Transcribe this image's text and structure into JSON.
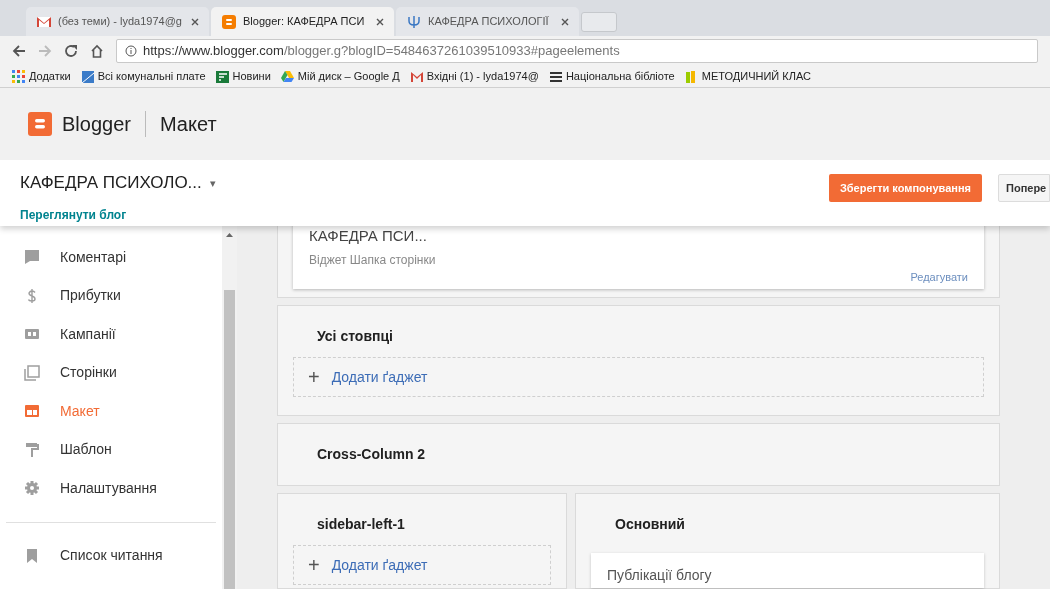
{
  "browser": {
    "tabs": [
      {
        "label": "(без теми) - lyda1974@g",
        "kind": "mail",
        "selected": false
      },
      {
        "label": "Blogger: КАФЕДРА ПСИ",
        "kind": "blogger",
        "selected": true
      },
      {
        "label": "КАФЕДРА ПСИХОЛОГІЇ",
        "kind": "psi",
        "selected": false
      }
    ],
    "url_host": "https://www.blogger.com",
    "url_path": "/blogger.g?blogID=5484637261039510933#pageelements",
    "bookmarks": [
      {
        "label": "Додатки",
        "kind": "apps"
      },
      {
        "label": "Всі комунальні плате",
        "kind": "page"
      },
      {
        "label": "Новини",
        "kind": "news"
      },
      {
        "label": "Мій диск – Google Д",
        "kind": "drive"
      },
      {
        "label": "Вхідні (1) - lyda1974@",
        "kind": "mail"
      },
      {
        "label": "Національна бібліоте",
        "kind": "lib"
      },
      {
        "label": "МЕТОДИЧНИЙ КЛАС",
        "kind": "book"
      }
    ]
  },
  "app": {
    "name": "Blogger",
    "section": "Макет"
  },
  "blog_header": {
    "title": "КАФЕДРА ПСИХОЛО...",
    "caret": "▾",
    "view_link": "Переглянути блог",
    "save_button": "Зберегти компонування",
    "preview_button": "Попере"
  },
  "sidebar": {
    "items": [
      {
        "label": "Коментарі",
        "selected": false
      },
      {
        "label": "Прибутки",
        "selected": false
      },
      {
        "label": "Кампанії",
        "selected": false
      },
      {
        "label": "Сторінки",
        "selected": false
      },
      {
        "label": "Макет",
        "selected": true
      },
      {
        "label": "Шаблон",
        "selected": false
      },
      {
        "label": "Налаштування",
        "selected": false
      }
    ],
    "bottom_items": [
      {
        "label": "Список читання",
        "selected": false
      }
    ]
  },
  "layout": {
    "header_widget": {
      "title": "КАФЕДРА ПСИ...",
      "subtitle": "Віджет Шапка сторінки",
      "edit": "Редагувати"
    },
    "all_columns": {
      "title": "Усі стовпці",
      "add": "Додати ґаджет",
      "plus": "+"
    },
    "cross_column": {
      "title": "Cross-Column 2"
    },
    "sidebar_left": {
      "title": "sidebar-left-1",
      "add": "Додати ґаджет",
      "plus": "+"
    },
    "main": {
      "title": "Основний",
      "widget": "Публікації блогу"
    }
  }
}
